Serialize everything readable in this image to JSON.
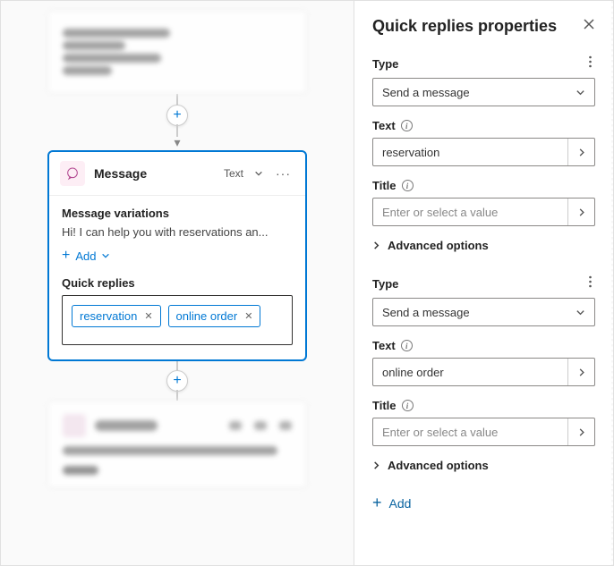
{
  "canvas": {
    "node": {
      "title": "Message",
      "type_label": "Text",
      "variations_label": "Message variations",
      "variation_preview": "Hi! I can help you with reservations an...",
      "add_label": "Add",
      "quick_replies_label": "Quick replies",
      "chips": [
        {
          "text": "reservation"
        },
        {
          "text": "online order"
        }
      ]
    }
  },
  "panel": {
    "title": "Quick replies properties",
    "labels": {
      "type": "Type",
      "text": "Text",
      "title": "Title",
      "advanced": "Advanced options",
      "add": "Add"
    },
    "placeholders": {
      "title_value": "Enter or select a value"
    },
    "items": [
      {
        "type_value": "Send a message",
        "text_value": "reservation",
        "title_value": ""
      },
      {
        "type_value": "Send a message",
        "text_value": "online order",
        "title_value": ""
      }
    ]
  }
}
